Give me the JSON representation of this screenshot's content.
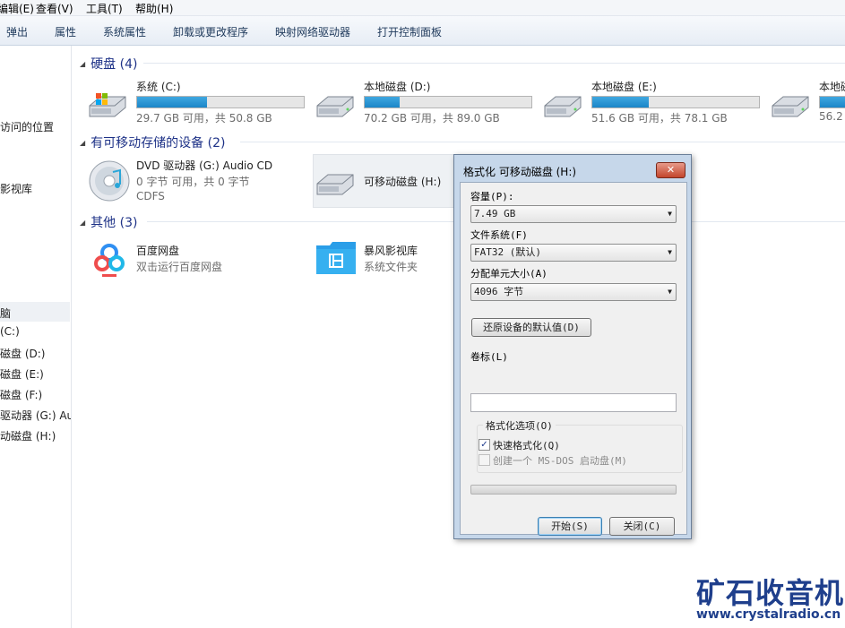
{
  "menubar": [
    "编辑(E)",
    "查看(V)",
    "工具(T)",
    "帮助(H)"
  ],
  "toolbar": [
    "弹出",
    "属性",
    "系统属性",
    "卸载或更改程序",
    "映射网络驱动器",
    "打开控制面板"
  ],
  "nav": {
    "partial_top": [
      "访问的位置",
      "影视库"
    ],
    "items": [
      "脑",
      "(C:)",
      "磁盘 (D:)",
      "磁盘 (E:)",
      "磁盘 (F:)",
      "驱动器 (G:) Au",
      "动磁盘 (H:)"
    ]
  },
  "groups": {
    "hard_disks": {
      "header": "硬盘 (4)",
      "drives": [
        {
          "name": "系统 (C:)",
          "info": "29.7 GB 可用，共 50.8 GB",
          "used_fraction": 0.42
        },
        {
          "name": "本地磁盘 (D:)",
          "info": "70.2 GB 可用，共 89.0 GB",
          "used_fraction": 0.21
        },
        {
          "name": "本地磁盘 (E:)",
          "info": "51.6 GB 可用，共 78.1 GB",
          "used_fraction": 0.34
        },
        {
          "name": "本地磁",
          "info": "56.2",
          "used_fraction": 0.5
        }
      ]
    },
    "removable": {
      "header": "有可移动存储的设备 (2)",
      "dvd": {
        "name": "DVD 驱动器 (G:) Audio CD",
        "line2": "0 字节 可用，共 0 字节",
        "line3": "CDFS"
      },
      "usb": {
        "name": "可移动磁盘 (H:)"
      }
    },
    "other": {
      "header": "其他 (3)",
      "items": [
        {
          "name": "百度网盘",
          "sub": "双击运行百度网盘"
        },
        {
          "name": "暴风影视库",
          "sub": "系统文件夹"
        }
      ]
    }
  },
  "dialog": {
    "title": "格式化 可移动磁盘 (H:)",
    "close_glyph": "✕",
    "capacity_label": "容量(P):",
    "capacity_value": "7.49 GB",
    "fs_label": "文件系统(F)",
    "fs_value": "FAT32 (默认)",
    "alloc_label": "分配单元大小(A)",
    "alloc_value": "4096 字节",
    "restore_button": "还原设备的默认值(D)",
    "volume_label": "卷标(L)",
    "volume_value": "",
    "options_legend": "格式化选项(O)",
    "quick_format": "快速格式化(Q)",
    "quick_format_checked": true,
    "msdos": "创建一个 MS-DOS 启动盘(M)",
    "msdos_checked": false,
    "progress": 0,
    "start_button": "开始(S)",
    "close_button": "关闭(C)"
  },
  "watermark": {
    "title": "矿石收音机",
    "url": "www.crystalradio.cn"
  },
  "colors": {
    "accent": "#1b86c8",
    "header": "#1e3287",
    "watermark": "#1f3f8c"
  }
}
